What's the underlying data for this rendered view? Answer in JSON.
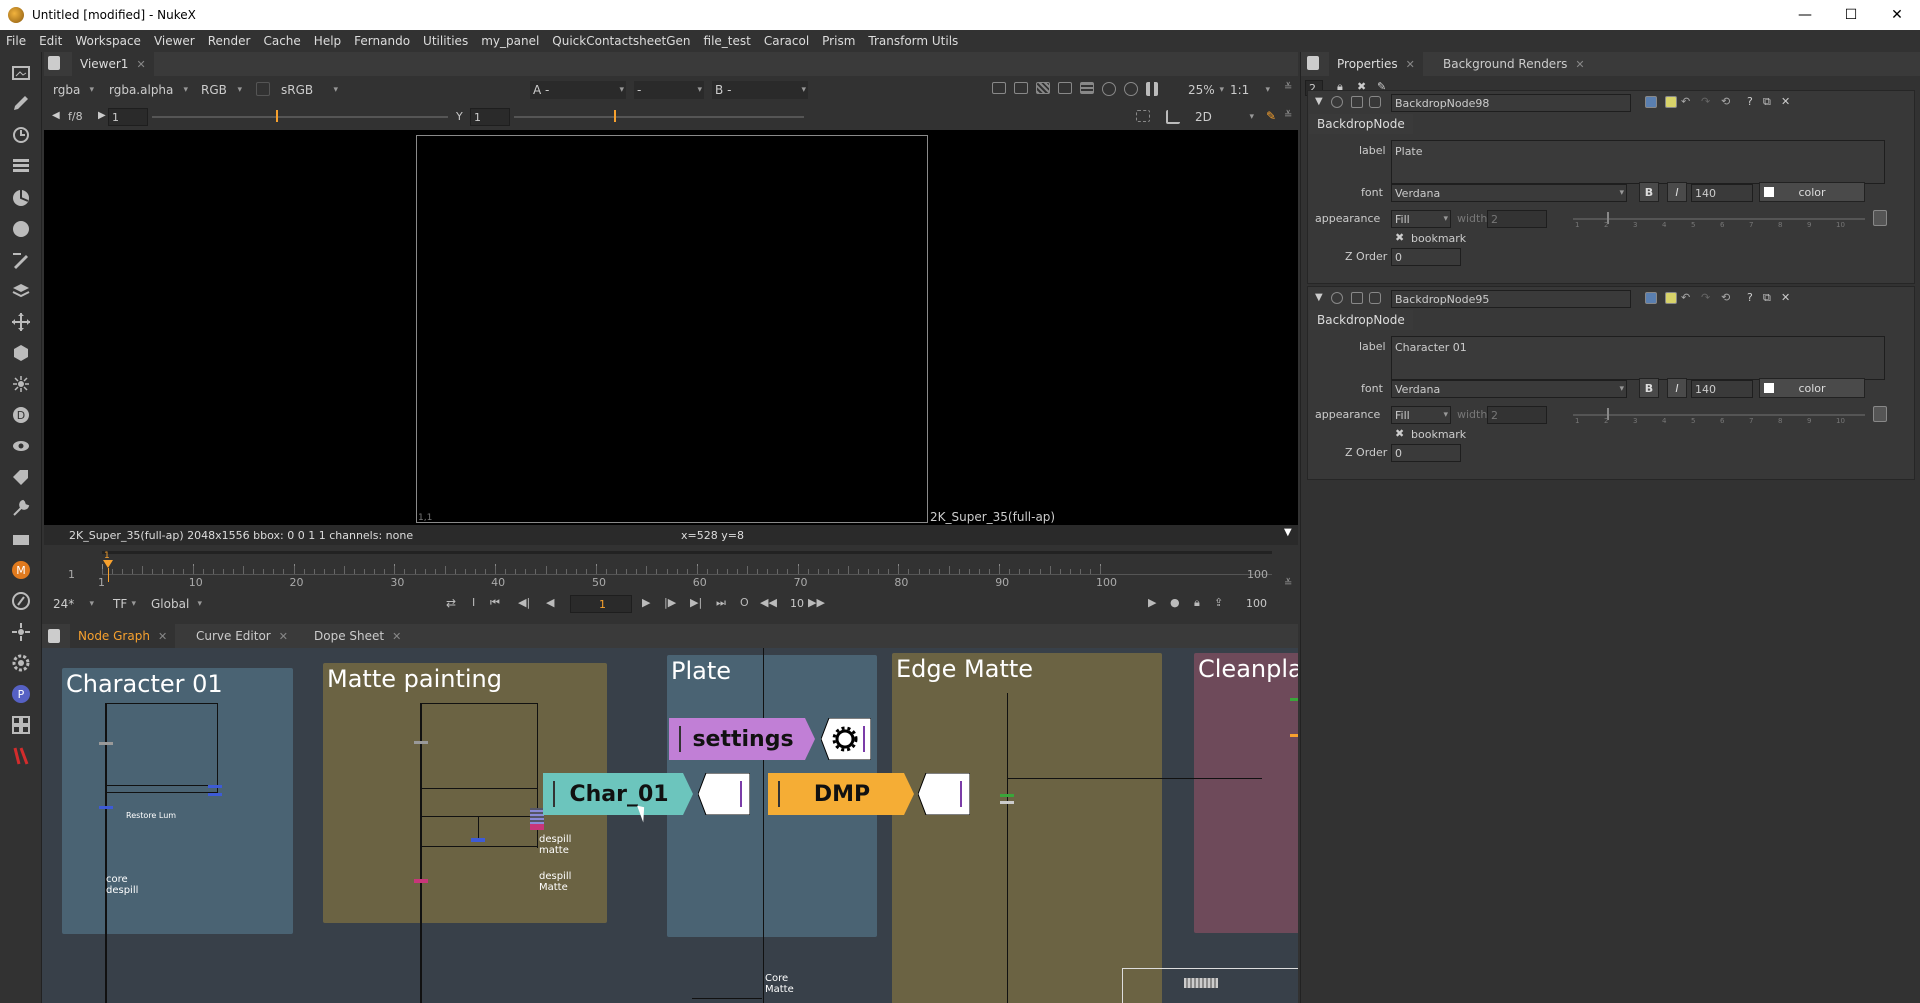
{
  "window": {
    "title": "Untitled [modified] - NukeX",
    "minimize": "—",
    "maximize": "☐",
    "close": "✕"
  },
  "menu": [
    "File",
    "Edit",
    "Workspace",
    "Viewer",
    "Render",
    "Cache",
    "Help",
    "Fernando",
    "Utilities",
    "my_panel",
    "QuickContactsheetGen",
    "file_test",
    "Caracol",
    "Prism",
    "Transform Utils"
  ],
  "viewer": {
    "tab": "Viewer1",
    "channels": "rgba",
    "alpha": "rgba.alpha",
    "colorspace_rgb": "RGB",
    "lut": "sRGB",
    "input_a_label": "A",
    "input_a": "-",
    "input_mid": "-",
    "input_b_label": "B",
    "input_b": "-",
    "zoom": "25%",
    "ratio": "1:1",
    "fstop": "f/8",
    "gain_value": "1",
    "gamma_label": "Y",
    "gamma_value": "1",
    "view_mode": "2D",
    "format_label": "2K_Super_35(full-ap)",
    "corner_label": "1,1",
    "status_info": "2K_Super_35(full-ap) 2048x1556  bbox: 0 0 1 1 channels: none",
    "cursor": "x=528 y=8"
  },
  "timeline": {
    "start": "1",
    "end": "100",
    "ticks": [
      "1",
      "10",
      "20",
      "30",
      "40",
      "50",
      "60",
      "70",
      "80",
      "90",
      "100"
    ],
    "current_marker": "1",
    "fps": "24*",
    "tf": "TF",
    "scope": "Global",
    "current_frame": "1",
    "step": "10",
    "end_frame": "100"
  },
  "nodegraph": {
    "tabs": [
      "Node Graph",
      "Curve Editor",
      "Dope Sheet"
    ],
    "backdrops": [
      "Character 01",
      "Matte painting",
      "Plate",
      "Edge Matte",
      "Cleanplat"
    ],
    "tags": {
      "settings": "settings",
      "char": "Char_01",
      "dmp": "DMP"
    },
    "labels": {
      "restore": "Restore Lum",
      "core_despill": "core\ndespill",
      "despill_matte_1": "despill\nmatte",
      "despill_matte_2": "despill\nMatte",
      "core_matte": "Core\nMatte"
    }
  },
  "properties": {
    "tabs": [
      "Properties",
      "Background Renders"
    ],
    "max_panels": "2",
    "panels": [
      {
        "name": "BackdropNode98",
        "class": "BackdropNode",
        "label_caption": "label",
        "label": "Plate",
        "font_caption": "font",
        "font": "Verdana",
        "bold": "B",
        "italic": "I",
        "size": "140",
        "color_btn": "color",
        "appearance_caption": "appearance",
        "appearance": "Fill",
        "width_caption": "width",
        "width": "2",
        "bookmark": "bookmark",
        "zorder_caption": "Z Order",
        "zorder": "0"
      },
      {
        "name": "BackdropNode95",
        "class": "BackdropNode",
        "label_caption": "label",
        "label": "Character 01",
        "font_caption": "font",
        "font": "Verdana",
        "bold": "B",
        "italic": "I",
        "size": "140",
        "color_btn": "color",
        "appearance_caption": "appearance",
        "appearance": "Fill",
        "width_caption": "width",
        "width": "2",
        "bookmark": "bookmark",
        "zorder_caption": "Z Order",
        "zorder": "0"
      }
    ],
    "slider_ticks": [
      "1",
      "2",
      "3",
      "4",
      "5",
      "6",
      "7",
      "8",
      "9",
      "10"
    ]
  },
  "colors": {
    "char_bd": "#4a6373",
    "matte_bd": "#6b6343",
    "plate_bd": "#4a6373",
    "edge_bd": "#6b6343",
    "clean_bd": "#6e4a5a",
    "settings_tag": "#c17fd6",
    "char_tag": "#6cc5bd",
    "dmp_tag": "#f5ad35",
    "accent": "#f7a12e"
  }
}
